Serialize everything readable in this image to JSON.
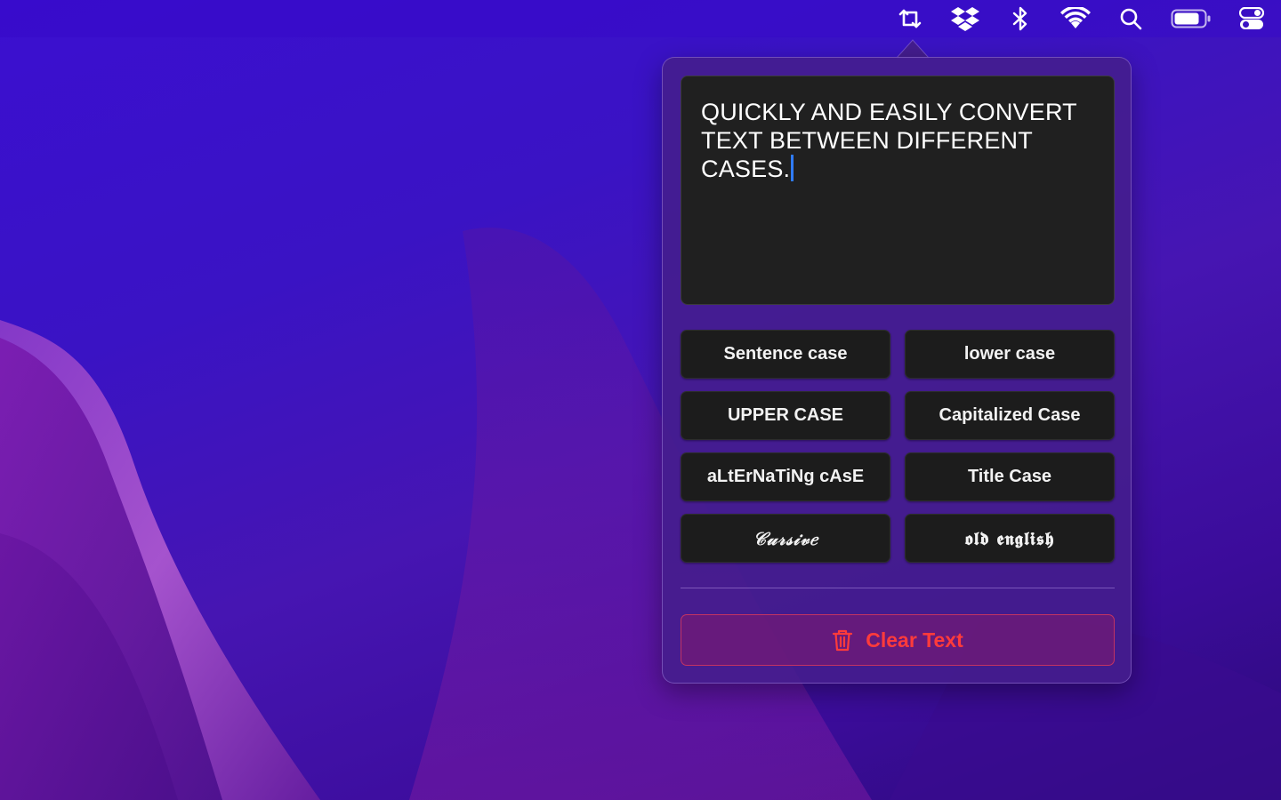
{
  "colors": {
    "accent_red": "#ff3b3b",
    "caret_blue": "#2f7bff",
    "button_bg": "#1c1c1c",
    "editor_bg": "#202020"
  },
  "menubar": {
    "icons": [
      "convert-arrows-icon",
      "dropbox-icon",
      "bluetooth-icon",
      "wifi-icon",
      "search-icon",
      "battery-icon",
      "control-center-icon"
    ]
  },
  "editor": {
    "value": "QUICKLY AND EASILY CONVERT TEXT BETWEEN DIFFERENT CASES."
  },
  "cases": {
    "sentence": "Sentence case",
    "lower": "lower case",
    "upper": "UPPER CASE",
    "capitalized": "Capitalized Case",
    "alternating": "aLtErNaTiNg cAsE",
    "title": "Title Case",
    "cursive": "𝒞𝓊𝓇𝓈𝒾𝓋𝑒",
    "old_english": "𝖔𝖑𝖉 𝖊𝖓𝖌𝖑𝖎𝖘𝖍"
  },
  "clear": {
    "label": "Clear Text",
    "icon": "trash-icon"
  }
}
